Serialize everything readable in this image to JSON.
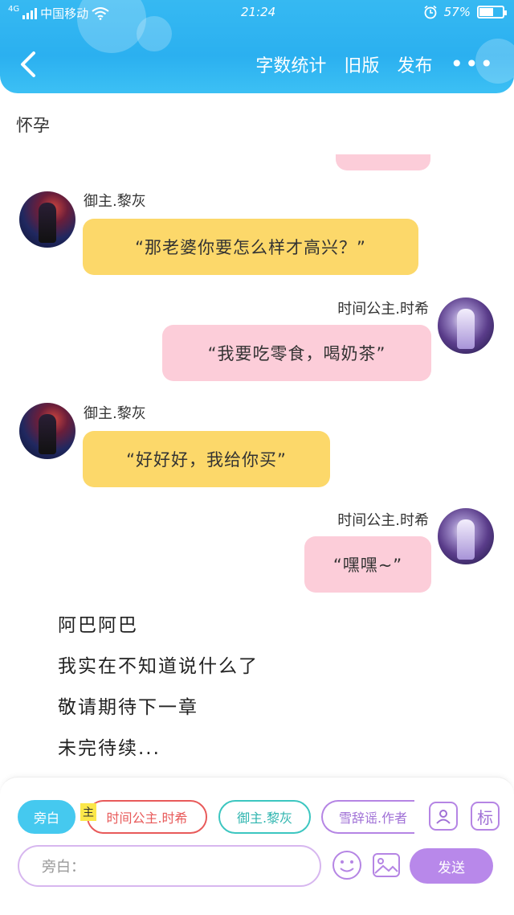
{
  "status_bar": {
    "network": "4G",
    "carrier": "中国移动",
    "time": "21:24",
    "battery": "57%"
  },
  "header": {
    "back_icon": "chevron-left-icon",
    "actions": [
      "字数统计",
      "旧版",
      "发布"
    ],
    "more_icon": "more-dots-icon",
    "color": "#2bb0f0"
  },
  "chapter_title": "怀孕",
  "messages": [
    {
      "side": "left",
      "sender": "御主.黎灰",
      "text": "“那老婆你要怎么样才高兴？”",
      "color": "#fcd86a"
    },
    {
      "side": "right",
      "sender": "时间公主.时希",
      "text": "“我要吃零食，喝奶茶”",
      "color": "#fccdd9"
    },
    {
      "side": "left",
      "sender": "御主.黎灰",
      "text": "“好好好，我给你买”",
      "color": "#fcd86a"
    },
    {
      "side": "right",
      "sender": "时间公主.时希",
      "text": "“嘿嘿~”",
      "color": "#fccdd9"
    }
  ],
  "narration": [
    "阿巴阿巴",
    "我实在不知道说什么了",
    "敬请期待下一章",
    "未完待续..."
  ],
  "composer": {
    "role_chips": [
      "旁白",
      "时间公主.时希",
      "御主.黎灰",
      "雪辞谣.作者"
    ],
    "main_tag": "主",
    "contacts_icon": "person-card-icon",
    "tag_button": "标",
    "input_placeholder": "旁白：",
    "emoji_icon": "smile-icon",
    "image_icon": "image-icon",
    "send_label": "发送",
    "send_color": "#b888ea"
  }
}
